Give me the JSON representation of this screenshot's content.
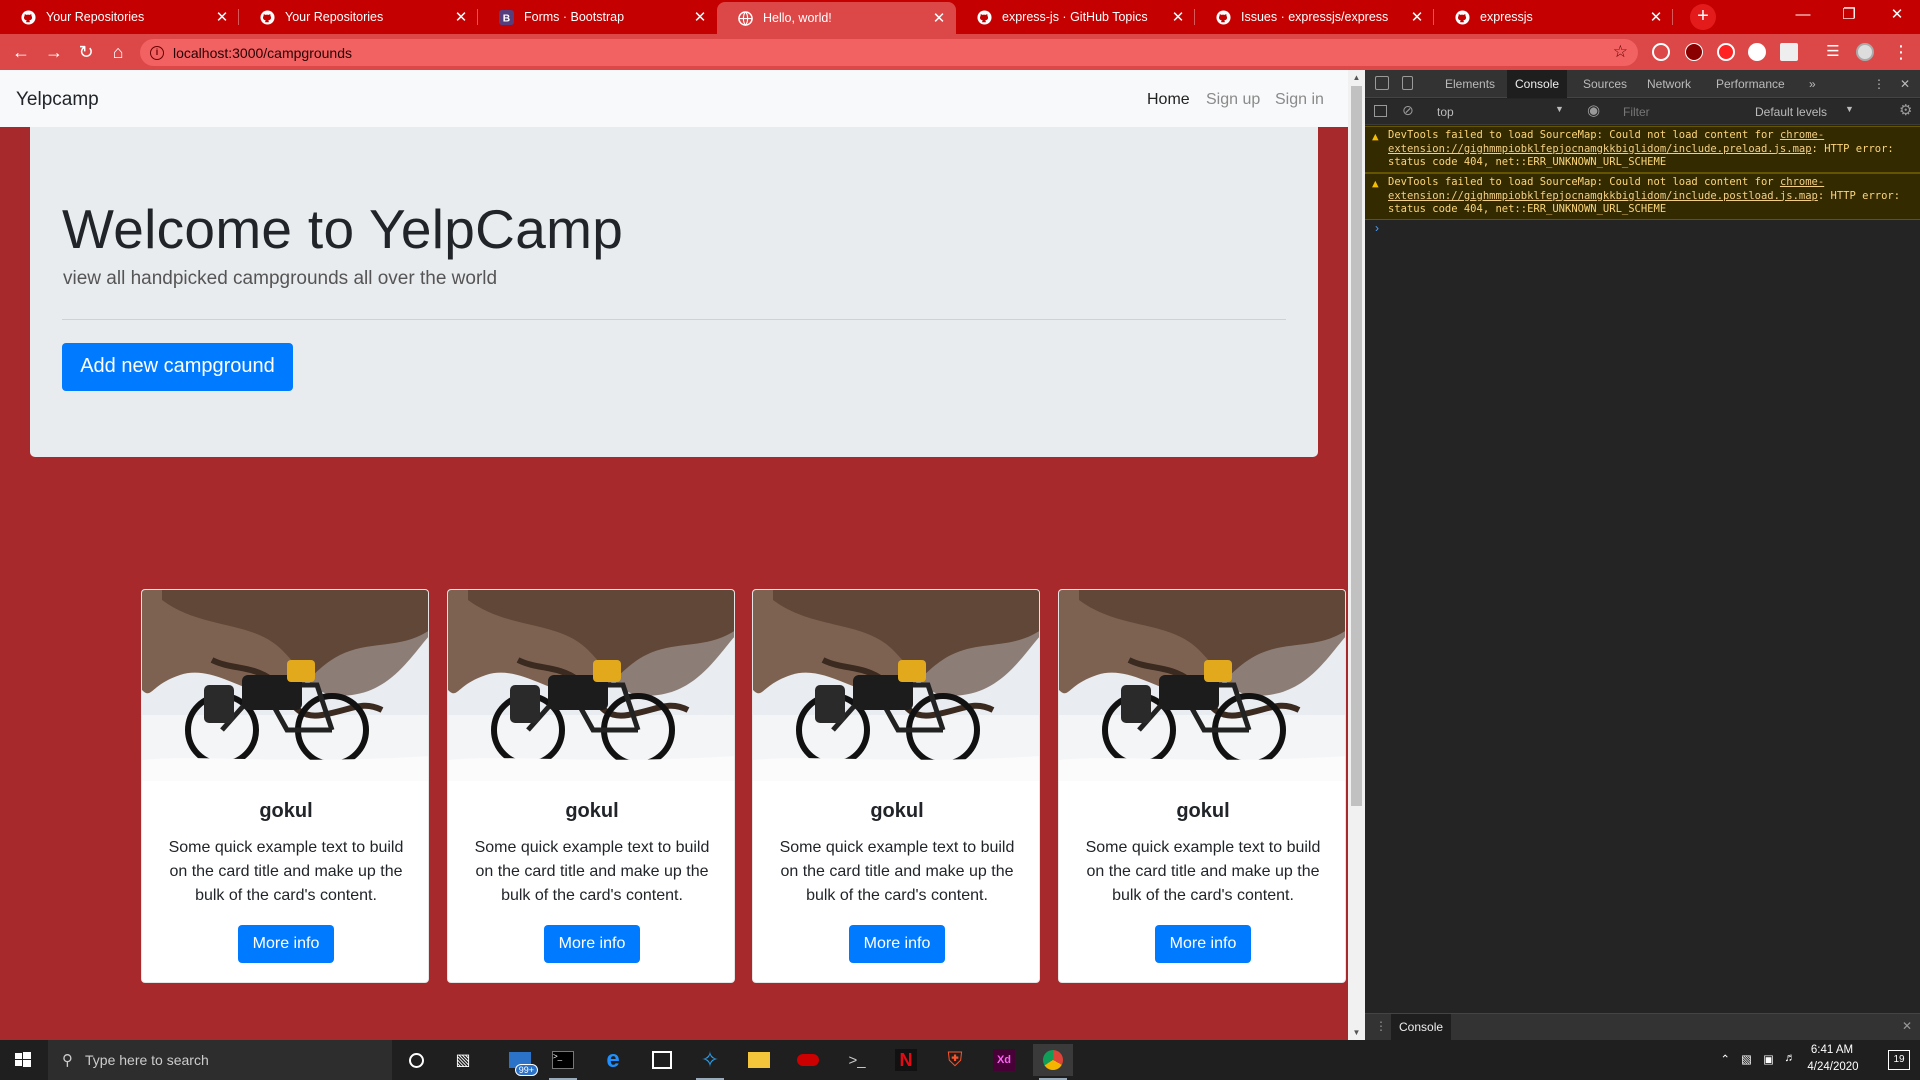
{
  "browser": {
    "tabs": [
      {
        "title": "Your Repositories",
        "icon": "github-icon"
      },
      {
        "title": "Your Repositories",
        "icon": "github-icon"
      },
      {
        "title": "Forms · Bootstrap",
        "icon": "bootstrap-icon"
      },
      {
        "title": "Hello, world!",
        "icon": "globe-icon"
      },
      {
        "title": "express-js · GitHub Topics",
        "icon": "github-icon"
      },
      {
        "title": "Issues · expressjs/express",
        "icon": "github-icon"
      },
      {
        "title": "expressjs",
        "icon": "github-icon"
      }
    ],
    "active_tab_index": 3,
    "url": "localhost:3000/campgrounds"
  },
  "page": {
    "navbar": {
      "brand": "Yelpcamp",
      "links": [
        "Home",
        "Sign up",
        "Sign in"
      ],
      "active_link": "Home"
    },
    "jumbotron": {
      "title": "Welcome to YelpCamp",
      "lead": "view all handpicked campgrounds all over the world",
      "button": "Add new campground"
    },
    "cards": [
      {
        "title": "gokul",
        "text": "Some quick example text to build on the card title and make up the bulk of the card's content.",
        "button": "More info"
      },
      {
        "title": "gokul",
        "text": "Some quick example text to build on the card title and make up the bulk of the card's content.",
        "button": "More info"
      },
      {
        "title": "gokul",
        "text": "Some quick example text to build on the card title and make up the bulk of the card's content.",
        "button": "More info"
      },
      {
        "title": "gokul",
        "text": "Some quick example text to build on the card title and make up the bulk of the card's content.",
        "button": "More info"
      }
    ]
  },
  "devtools": {
    "tabs": [
      "Elements",
      "Console",
      "Sources",
      "Network",
      "Performance"
    ],
    "active_tab": "Console",
    "context": "top",
    "filter_placeholder": "Filter",
    "levels": "Default levels",
    "messages": [
      {
        "prefix": "DevTools failed to load SourceMap: Could not load content for ",
        "link": "chrome-extension://gighmmpiobklfepjocnamgkkbiglidom/include.preload.js.map",
        "suffix": ": HTTP error: status code 404, net::ERR_UNKNOWN_URL_SCHEME"
      },
      {
        "prefix": "DevTools failed to load SourceMap: Could not load content for ",
        "link": "chrome-extension://gighmmpiobklfepjocnamgkkbiglidom/include.postload.js.map",
        "suffix": ": HTTP error: status code 404, net::ERR_UNKNOWN_URL_SCHEME"
      }
    ],
    "drawer_tab": "Console"
  },
  "taskbar": {
    "search_placeholder": "Type here to search",
    "mail_badge": "99+",
    "time": "6:41 AM",
    "date": "4/24/2020",
    "notifications": "19"
  },
  "colors": {
    "tab_strip": "#c40000",
    "toolbar": "#dc4848",
    "page_background": "#a8292c",
    "primary_button": "#007bff",
    "jumbotron": "#e9ecef"
  }
}
